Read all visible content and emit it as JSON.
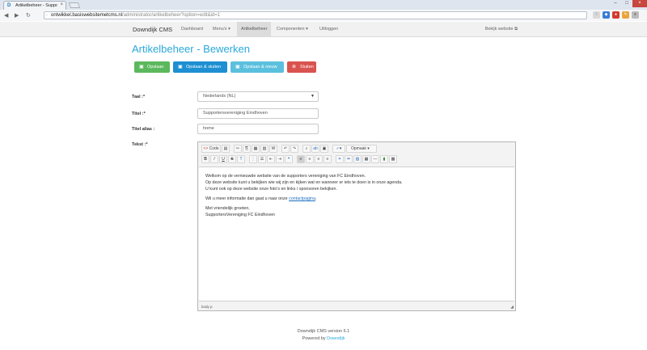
{
  "browser": {
    "tab_title": "Artikelbeheer - Supporters",
    "favicon": "D",
    "url_host": "ontwikkel.basiswebsitemetcms.nl",
    "url_path": "/administrator/artikelbeheer?option=edit&id=1"
  },
  "navbar": {
    "brand": "Downdijk CMS",
    "items": [
      "Dashboard",
      "Menu's ▾",
      "Artikelbeheer",
      "Componenten ▾",
      "Uitloggen"
    ],
    "view_site": "Bekijk website ⧉"
  },
  "page": {
    "title": "Artikelbeheer - Bewerken"
  },
  "buttons": {
    "save": "Opslaan",
    "save_close": "Opslaan & sluiten",
    "save_new": "Opslaan & nieuw",
    "close": "Sluiten"
  },
  "form": {
    "language_label": "Taal :*",
    "language_value": "Nederlands (NL)",
    "title_label": "Titel :*",
    "title_value": "Supportersvereniging Eindhoven",
    "alias_label": "Titel alias :",
    "alias_value": "home",
    "text_label": "Tekst :*"
  },
  "editor": {
    "code_button": "Code",
    "format_combo": "Opmaak",
    "line1": "Welkom op de vernieuwde website van de supporters vereniging van FC Eindhoven.",
    "line2": "Op deze website kunt u bekijken wie wij zijn en kijken wat en wanneer er iets te doen is in onze agenda.",
    "line3": "U kunt ook op deze website onze foto's en links / sponsoren bekijken.",
    "line4_pre": "Wil u meer informatie dan gaat u naar onze ",
    "line4_link": "contactpagina",
    "line4_post": ".",
    "line5": "Met vriendelijk groeten,",
    "line6": "SupportersVereniging FC Eindhoven",
    "status_path": "body  p"
  },
  "footer": {
    "version": "Downdijk CMS version 6.1",
    "powered_by": "Powered by ",
    "powered_link": "Downdijk"
  },
  "colors": {
    "accent": "#2aa9d9",
    "save": "#5cb85c",
    "save_close": "#1d8fd2",
    "save_new": "#5bc0de",
    "close": "#d9534f"
  }
}
